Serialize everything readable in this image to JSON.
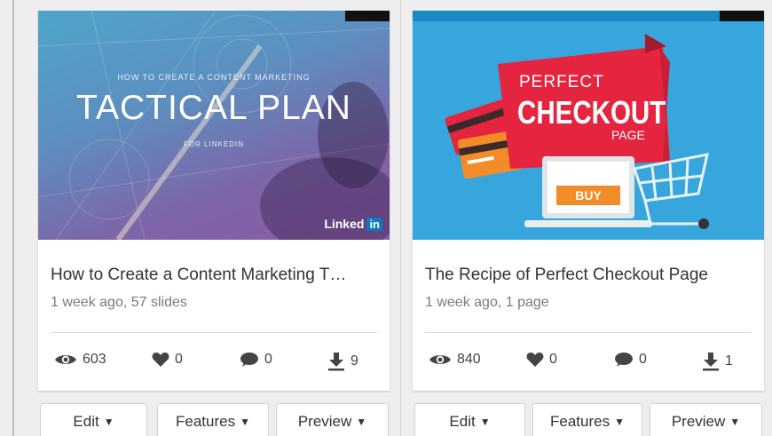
{
  "cards": [
    {
      "title": "How to Create a Content Marketing T…",
      "meta": "1 week ago, 57 slides",
      "thumbnail": {
        "kicker": "HOW TO CREATE A CONTENT MARKETING",
        "headline": "TACTICAL PLAN",
        "sub": "FOR LINKEDIN",
        "logo_text": "Linked",
        "logo_badge": "in"
      },
      "stats": {
        "views": "603",
        "likes": "0",
        "comments": "0",
        "downloads": "9"
      },
      "buttons": {
        "edit": "Edit",
        "features": "Features",
        "preview": "Preview"
      }
    },
    {
      "title": "The Recipe of Perfect Checkout Page",
      "meta": "1 week ago, 1 page",
      "thumbnail": {
        "line1": "PERFECT",
        "line2": "CHECKOUT",
        "line3": "PAGE",
        "button": "BUY"
      },
      "stats": {
        "views": "840",
        "likes": "0",
        "comments": "0",
        "downloads": "1"
      },
      "buttons": {
        "edit": "Edit",
        "features": "Features",
        "preview": "Preview"
      }
    }
  ],
  "icons": {
    "views": "eye-icon",
    "likes": "heart-icon",
    "comments": "speech-bubble-icon",
    "downloads": "download-icon",
    "caret": "caret-down-icon"
  },
  "colors": {
    "background": "#eeeeee",
    "card": "#ffffff",
    "text": "#333333",
    "meta": "#7a7a7a",
    "icon": "#444444",
    "linkedin": "#0a7bc1",
    "checkout_red": "#e5243f",
    "checkout_sky": "#36a6dc",
    "buy_orange": "#f28c28"
  }
}
